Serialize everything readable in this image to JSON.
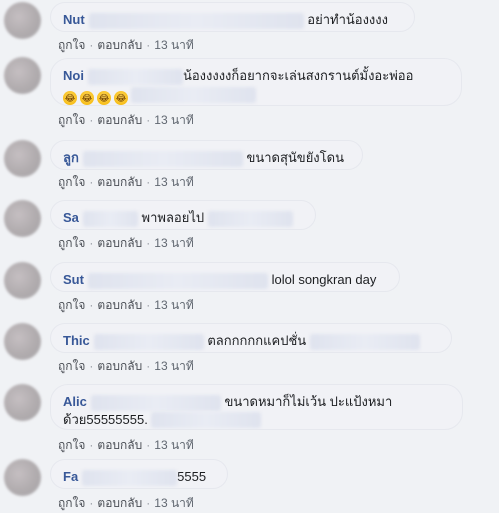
{
  "common": {
    "like": "ถูกใจ",
    "reply": "ตอบกลับ",
    "time": "13 นาที",
    "separator": "·"
  },
  "comments": [
    {
      "name": "Nut",
      "text": "อย่าทำน้องงงง"
    },
    {
      "name": "Noi",
      "text": "น้องงงงงก็อยากจะเล่นสงกรานต์มั้งอะพ่ออ",
      "emoji_row": [
        "😂",
        "😂",
        "😂",
        "😂"
      ]
    },
    {
      "name": "ลูก",
      "text": "ขนาดสุนัขยังโดน"
    },
    {
      "name": "Sa",
      "text": "พาพลอยไป"
    },
    {
      "name": "Sut",
      "text": "lolol songkran day"
    },
    {
      "name": "Thic",
      "text": "ตลกกกกกแคปชั่น"
    },
    {
      "name": "Alic",
      "text": "ขนาดหมาก็ไม่เว้น ปะแป้งหมา",
      "text2": "ด้วย55555555."
    },
    {
      "name": "Fa",
      "text": "5555"
    }
  ]
}
